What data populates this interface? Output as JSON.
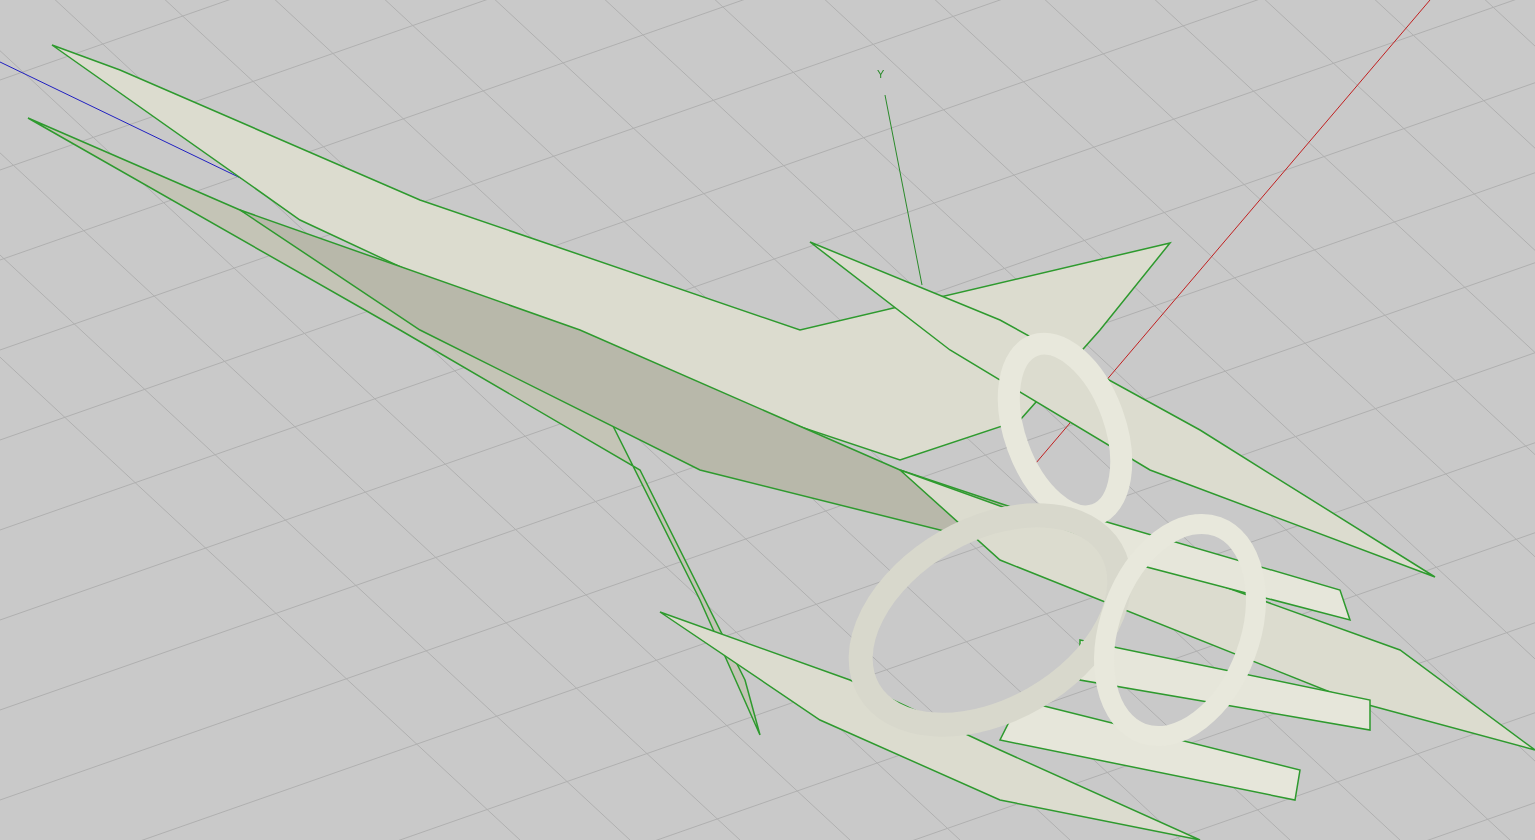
{
  "viewport": {
    "axis_label": "Y"
  }
}
